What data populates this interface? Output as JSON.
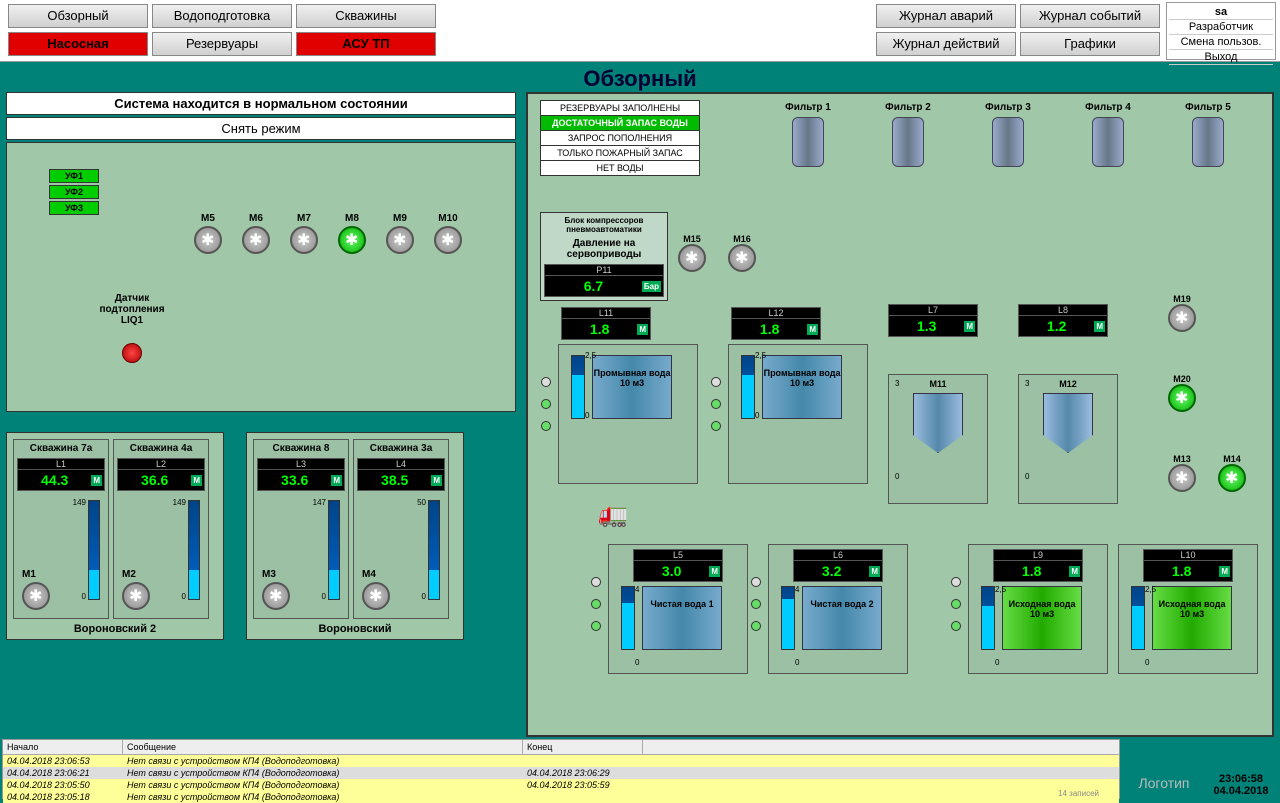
{
  "nav": {
    "left": [
      "Обзорный",
      "Водоподготовка",
      "Скважины",
      "Насосная",
      "Резервуары",
      "АСУ ТП"
    ],
    "left_red": [
      false,
      false,
      false,
      true,
      false,
      true
    ],
    "right": [
      "Журнал аварий",
      "Журнал событий",
      "Журнал действий",
      "Графики"
    ]
  },
  "user": {
    "name": "sa",
    "role": "Разработчик",
    "switch": "Смена пользов.",
    "exit": "Выход"
  },
  "title": "Обзорный",
  "status_line": "Система находится в нормальном  состоянии",
  "mode_btn": "Снять режим",
  "uf": [
    "УФ1",
    "УФ2",
    "УФ3"
  ],
  "liq": {
    "label": "Датчик подтопления LIQ1"
  },
  "pumps_top": [
    "M5",
    "M6",
    "M7",
    "M8",
    "M9",
    "M10"
  ],
  "pumps_top_on": [
    false,
    false,
    false,
    true,
    false,
    false
  ],
  "wells": {
    "group1": {
      "name": "Вороновский 2",
      "items": [
        {
          "name": "Скважина 7а",
          "l": "L1",
          "val": "44.3",
          "unit": "М",
          "scale_hi": "149",
          "scale_lo": "0",
          "pump": "M1"
        },
        {
          "name": "Скважина 4а",
          "l": "L2",
          "val": "36.6",
          "unit": "М",
          "scale_hi": "149",
          "scale_lo": "0",
          "pump": "M2"
        }
      ]
    },
    "group2": {
      "name": "Вороновский",
      "items": [
        {
          "name": "Скважина 8",
          "l": "L3",
          "val": "33.6",
          "unit": "М",
          "scale_hi": "147",
          "scale_lo": "0",
          "pump": "M3"
        },
        {
          "name": "Скважина 3а",
          "l": "L4",
          "val": "38.5",
          "unit": "М",
          "scale_hi": "50",
          "scale_lo": "0",
          "pump": "M4"
        }
      ]
    }
  },
  "reservoir_status": [
    "РЕЗЕРВУАРЫ ЗАПОЛНЕНЫ",
    "ДОСТАТОЧНЫЙ ЗАПАС ВОДЫ",
    "ЗАПРОС ПОПОЛНЕНИЯ",
    "ТОЛЬКО ПОЖАРНЫЙ ЗАПАС",
    "НЕТ ВОДЫ"
  ],
  "reservoir_active_idx": 1,
  "compressor": {
    "title": "Блок компрессоров пневмоавтоматики",
    "sub": "Давление на сервоприводы",
    "p": "P11",
    "val": "6.7",
    "unit": "Бар"
  },
  "filters": [
    "Фильтр 1",
    "Фильтр 2",
    "Фильтр 3",
    "Фильтр 4",
    "Фильтр 5"
  ],
  "pumps_mid": {
    "m15": "M15",
    "m16": "M16",
    "m19": "M19",
    "m20": "M20",
    "m13": "M13",
    "m14": "M14"
  },
  "levels": {
    "l7": {
      "name": "L7",
      "val": "1.3",
      "unit": "М"
    },
    "l8": {
      "name": "L8",
      "val": "1.2",
      "unit": "М"
    },
    "l11": {
      "name": "L11",
      "val": "1.8",
      "unit": "М"
    },
    "l12": {
      "name": "L12",
      "val": "1.8",
      "unit": "М"
    },
    "l5": {
      "name": "L5",
      "val": "3.0",
      "unit": "М"
    },
    "l6": {
      "name": "L6",
      "val": "3.2",
      "unit": "М"
    },
    "l9": {
      "name": "L9",
      "val": "1.8",
      "unit": "М"
    },
    "l10": {
      "name": "L10",
      "val": "1.8",
      "unit": "М"
    }
  },
  "tanks": {
    "wash1": {
      "label": "Промывная вода 10 м3",
      "scale_hi": "2,5",
      "scale_lo": "0"
    },
    "wash2": {
      "label": "Промывная вода 10 м3",
      "scale_hi": "2,5",
      "scale_lo": "0"
    },
    "cone1": {
      "label": "M11",
      "scale_hi": "3",
      "scale_lo": "0"
    },
    "cone2": {
      "label": "M12",
      "scale_hi": "3",
      "scale_lo": "0"
    },
    "clean1": {
      "label": "Чистая вода 1",
      "scale_hi": "4",
      "scale_lo": "0"
    },
    "clean2": {
      "label": "Чистая вода 2",
      "scale_hi": "4",
      "scale_lo": "0"
    },
    "src1": {
      "label": "Исходная вода 10 м3",
      "scale_hi": "2,5",
      "scale_lo": "0"
    },
    "src2": {
      "label": "Исходная вода 10 м3",
      "scale_hi": "2,5",
      "scale_lo": "0"
    }
  },
  "log": {
    "headers": [
      "Начало",
      "Сообщение",
      "Конец"
    ],
    "rows": [
      {
        "t1": "04.04.2018 23:06:53",
        "msg": "Нет связи с устройством КП4 (Водоподготовка)",
        "t2": "",
        "cls": "a"
      },
      {
        "t1": "04.04.2018 23:06:21",
        "msg": "Нет связи с устройством КП4 (Водоподготовка)",
        "t2": "04.04.2018 23:06:29",
        "cls": "b"
      },
      {
        "t1": "04.04.2018 23:05:50",
        "msg": "Нет связи с устройством КП4 (Водоподготовка)",
        "t2": "04.04.2018 23:05:59",
        "cls": "a"
      },
      {
        "t1": "04.04.2018 23:05:18",
        "msg": "Нет связи с устройством КП4 (Водоподготовка)",
        "t2": "",
        "cls": "a"
      }
    ],
    "footer": "14  записей"
  },
  "clock": {
    "time": "23:06:58",
    "date": "04.04.2018"
  },
  "logo": "Логотип"
}
